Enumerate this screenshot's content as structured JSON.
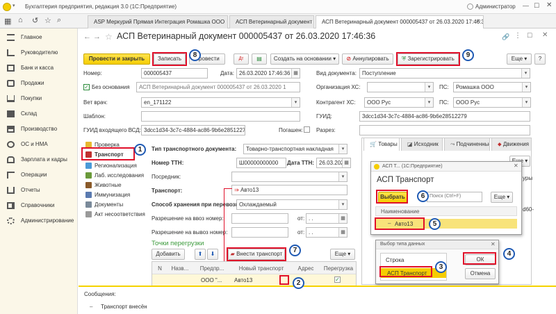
{
  "titlebar": {
    "title": "Бухгалтерия предприятия, редакция 3.0  (1С:Предприятие)",
    "user": "Администратор"
  },
  "tabs": [
    {
      "label": "ASP Меркурий Прямая Интеграция Ромашка ООО"
    },
    {
      "label": "АСП Ветеринарный документ"
    },
    {
      "label": "АСП Ветеринарный документ 000005437 от 26.03.2020 17:46:36"
    }
  ],
  "sidebar": {
    "items": [
      {
        "label": "Главное"
      },
      {
        "label": "Руководителю"
      },
      {
        "label": "Банк и касса"
      },
      {
        "label": "Продажи"
      },
      {
        "label": "Покупки"
      },
      {
        "label": "Склад"
      },
      {
        "label": "Производство"
      },
      {
        "label": "ОС и НМА"
      },
      {
        "label": "Зарплата и кадры"
      },
      {
        "label": "Операции"
      },
      {
        "label": "Отчеты"
      },
      {
        "label": "Справочники"
      },
      {
        "label": "Администрирование"
      }
    ]
  },
  "doc": {
    "title": "АСП Ветеринарный документ 000005437 от 26.03.2020 17:46:36",
    "toolbar": {
      "post_close": "Провести и закрыть",
      "save": "Записать",
      "post": "Провести",
      "create_based": "Создать на основании",
      "annul": "Аннулировать",
      "register": "Зарегистрировать",
      "more": "Еще"
    },
    "fields": {
      "number_label": "Номер:",
      "number": "000005437",
      "date_label": "Дата:",
      "date": "26.03.2020 17:46:36",
      "doctype_label": "Вид документа:",
      "doctype": "Поступление",
      "no_basis_label": "Без основания",
      "basis": "АСП Ветеринарный документ 000005437 от 26.03.2020 1",
      "org_label": "Организация ХС:",
      "org": "",
      "ps_label": "ПС:",
      "ps": "Ромашка ООО",
      "vet_label": "Вет врач:",
      "vet": "en_171122",
      "contractor_label": "Контрагент ХС:",
      "contractor": "ООО Рус",
      "ps2_label": "ПС:",
      "ps2": "ООО Рус",
      "template_label": "Шаблон:",
      "template": "",
      "guid_label": "ГУИД:",
      "guid": "3dcc1d34-3c7c-4884-ac86-9b6e28512279",
      "guid_in_label": "ГУИД входящего ВСД:",
      "guid_in": "3dcc1d34-3c7c-4884-ac86-9b6e28512279",
      "cancelled_label": "Погашен:",
      "split_label": "Разрез:",
      "split": ""
    },
    "leftnav": [
      {
        "label": "Проверка"
      },
      {
        "label": "Транспорт"
      },
      {
        "label": "Регионализация"
      },
      {
        "label": "Лаб. исследования"
      },
      {
        "label": "Животные"
      },
      {
        "label": "Иммунизация"
      },
      {
        "label": "Документы"
      },
      {
        "label": "Акт несоответствия"
      }
    ],
    "transport": {
      "doc_type_label": "Тип транспортного документа:",
      "doc_type": "Товарно-транспортная накладная",
      "ttn_num_label": "Номер ТТН:",
      "ttn_num": "Ш00000000000",
      "ttn_date_label": "Дата ТТН:",
      "ttn_date": "26.03.2020",
      "intermediary_label": "Посредник:",
      "intermediary": "",
      "transport_label": "Транспорт:",
      "transport": "Авто13",
      "storage_label": "Способ хранения при перевозке:",
      "storage": "Охлаждаемый",
      "permit_in_label": "Разрешение на ввоз номер:",
      "permit_in": "",
      "permit_out_label": "Разрешение на вывоз номер:",
      "permit_out": "",
      "from_label": "от:",
      "from_date": ".  .",
      "from_label2": "от:",
      "from_date2": ".  .",
      "transfer_header": "Точки перегрузки",
      "add_btn": "Добавить",
      "insert_btn": "Внести транспорт",
      "more_btn": "Еще",
      "cols": [
        "N",
        "Назв...",
        "Предпр...",
        "Новый транспорт",
        "Адрес",
        "Перегрузка"
      ],
      "row": {
        "name": "",
        "enterprise": "ООО \"...",
        "transport": "Авто13",
        "address": ""
      }
    },
    "right_tabs": [
      "Товары",
      "Исходник",
      "Подчиненные",
      "Движения"
    ],
    "right_more": "Еще",
    "right_stub": "уры",
    "right_stub2": "d60-"
  },
  "popup_transport": {
    "window_title": "АСП Т...  (1С:Предприятие)",
    "title": "АСП Транспорт",
    "select_btn": "Выбрать",
    "search_placeholder": "Поиск (Ctrl+F)",
    "more_btn": "Еще",
    "col_name": "Наименование",
    "item": "Авто13"
  },
  "popup_type": {
    "title": "Выбор типа данных",
    "items": [
      "Строка",
      "АСП Транспорт"
    ],
    "ok": "ОК",
    "cancel": "Отмена"
  },
  "messages": {
    "header": "Сообщения:",
    "item": "Транспорт внесён"
  },
  "annotations": [
    "1",
    "2",
    "3",
    "4",
    "5",
    "6",
    "7",
    "8",
    "9"
  ],
  "colors": {
    "accent_yellow": "#f5cd00",
    "annot_red": "#e0102a",
    "annot_blue": "#1f5ab4",
    "sidebar_bg": "#fbf7e8"
  }
}
